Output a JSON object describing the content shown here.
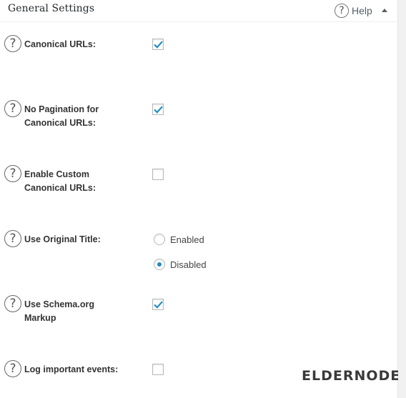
{
  "header": {
    "title": "General Settings",
    "help_label": "Help"
  },
  "help_glyph": "?",
  "settings": [
    {
      "label": "Canonical URLs:",
      "control": "checkbox",
      "checked": true
    },
    {
      "label": "No Pagination for Canonical URLs:",
      "control": "checkbox",
      "checked": true
    },
    {
      "label": "Enable Custom Canonical URLs:",
      "control": "checkbox",
      "checked": false
    },
    {
      "label": "Use Original Title:",
      "control": "radio",
      "options": [
        "Enabled",
        "Disabled"
      ],
      "selected": "Disabled"
    },
    {
      "label": "Use Schema.org Markup",
      "control": "checkbox",
      "checked": true
    },
    {
      "label": "Log important events:",
      "control": "checkbox",
      "checked": false
    }
  ],
  "watermark": {
    "text": "eldernode"
  },
  "colors": {
    "checkmark": "#1e8cbe",
    "radio_dot": "#1e8cbe",
    "brand_arrow": "#2fbfa0"
  }
}
